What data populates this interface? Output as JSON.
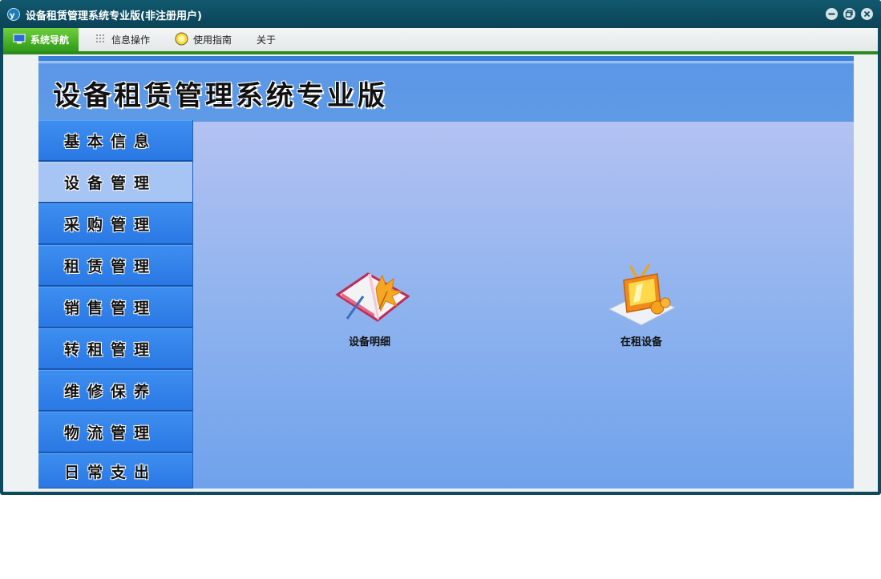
{
  "window": {
    "title": "设备租赁管理系统专业版(非注册用户)"
  },
  "menubar": {
    "items": [
      {
        "label": "系统导航",
        "icon": "monitor-icon",
        "active": true
      },
      {
        "label": "信息操作",
        "icon": "grid-icon",
        "active": false
      },
      {
        "label": "使用指南",
        "icon": "help-bulb-icon",
        "active": false
      },
      {
        "label": "关于",
        "icon": "",
        "active": false
      }
    ]
  },
  "banner": {
    "title": "设备租赁管理系统专业版"
  },
  "sidebar": {
    "items": [
      {
        "label": "基本信息"
      },
      {
        "label": "设备管理",
        "selected": true
      },
      {
        "label": "采购管理"
      },
      {
        "label": "租赁管理"
      },
      {
        "label": "销售管理"
      },
      {
        "label": "转租管理"
      },
      {
        "label": "维修保养"
      },
      {
        "label": "物流管理"
      },
      {
        "label": "日常支出"
      }
    ]
  },
  "content": {
    "tiles": [
      {
        "label": "设备明细",
        "icon": "book-leaf-icon"
      },
      {
        "label": "在租设备",
        "icon": "tv-icon"
      }
    ]
  },
  "colors": {
    "titlebar": "#0d4a5e",
    "menu_active": "#2f9b18",
    "sidebar_button": "#2a78e4",
    "sidebar_selected": "#a7c5f4",
    "banner": "#5b97e6"
  }
}
